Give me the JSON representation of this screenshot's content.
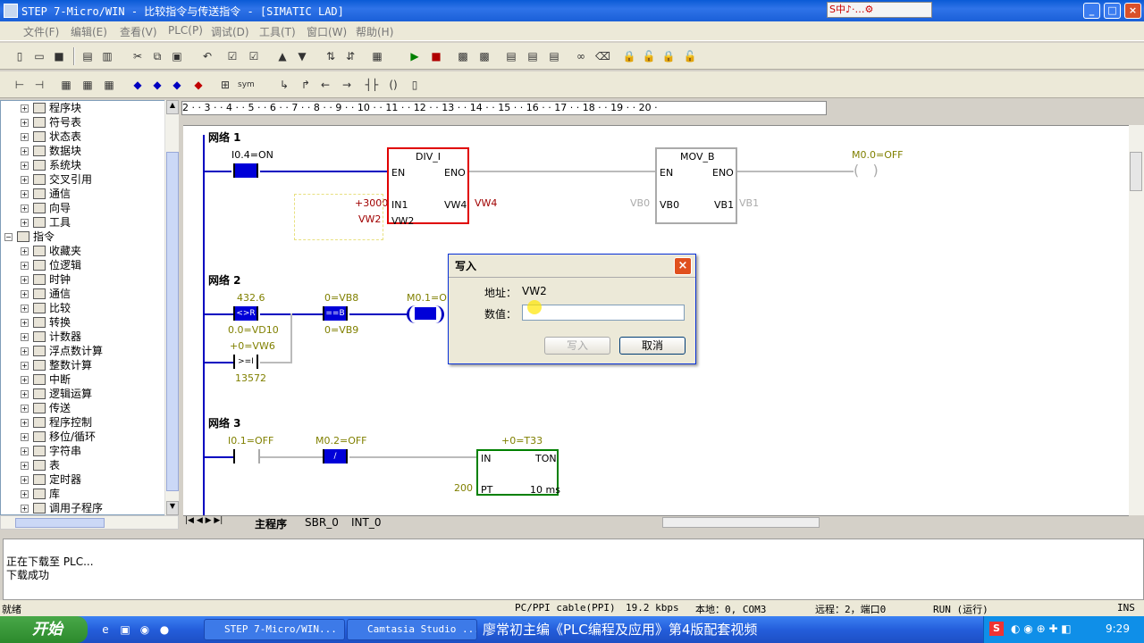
{
  "window": {
    "title": "STEP 7-Micro/WIN - 比较指令与传送指令 - [SIMATIC LAD]",
    "controls": {
      "min": "_",
      "max": "□",
      "close": "×"
    },
    "ime_text": "S中♪·…⚙"
  },
  "menu": [
    "文件(F)",
    "编辑(E)",
    "查看(V)",
    "PLC(P)",
    "调试(D)",
    "工具(T)",
    "窗口(W)",
    "帮助(H)"
  ],
  "tree": {
    "items": [
      {
        "label": "程序块",
        "level": 1
      },
      {
        "label": "符号表",
        "level": 1
      },
      {
        "label": "状态表",
        "level": 1
      },
      {
        "label": "数据块",
        "level": 1
      },
      {
        "label": "系统块",
        "level": 1
      },
      {
        "label": "交叉引用",
        "level": 1
      },
      {
        "label": "通信",
        "level": 1
      },
      {
        "label": "向导",
        "level": 1
      },
      {
        "label": "工具",
        "level": 1
      },
      {
        "label": "指令",
        "level": 0
      },
      {
        "label": "收藏夹",
        "level": 1
      },
      {
        "label": "位逻辑",
        "level": 1
      },
      {
        "label": "时钟",
        "level": 1
      },
      {
        "label": "通信",
        "level": 1
      },
      {
        "label": "比较",
        "level": 1
      },
      {
        "label": "转换",
        "level": 1
      },
      {
        "label": "计数器",
        "level": 1
      },
      {
        "label": "浮点数计算",
        "level": 1
      },
      {
        "label": "整数计算",
        "level": 1
      },
      {
        "label": "中断",
        "level": 1
      },
      {
        "label": "逻辑运算",
        "level": 1
      },
      {
        "label": "传送",
        "level": 1
      },
      {
        "label": "程序控制",
        "level": 1
      },
      {
        "label": "移位/循环",
        "level": 1
      },
      {
        "label": "字符串",
        "level": 1
      },
      {
        "label": "表",
        "level": 1
      },
      {
        "label": "定时器",
        "level": 1
      },
      {
        "label": "库",
        "level": 1
      },
      {
        "label": "调用子程序",
        "level": 1
      }
    ]
  },
  "ruler": "2 · · 3 · · 4 · · 5 · · 6 · · 7 · · 8 · · 9 · · 10 · · 11 · · 12 · · 13 · · 14 · · 15 · · 16 · · 17 · · 18 · · 19 · · 20 ·",
  "networks": {
    "n1": {
      "title": "网络 1",
      "contact": "I0.4=ON",
      "div": "DIV_I",
      "en": "EN",
      "eno": "ENO",
      "in1": "IN1",
      "in2": "VW2",
      "out": "VW4",
      "in1_val": "+3000",
      "in2_val": "VW2",
      "out_val": "VW4",
      "mov": "MOV_B",
      "mov_in": "VB0",
      "mov_out": "VB1",
      "mov_in_val": "VB0",
      "mov_out_val": "VB1",
      "coil": "M0.0=OFF"
    },
    "n2": {
      "title": "网络 2",
      "c1_top": "432.6",
      "c1_label": "<>R",
      "c1_bot": "0.0=VD10",
      "c2_top": "0=VB8",
      "c2_label": "==B",
      "c2_bot": "0=VB9",
      "coil": "M0.1=ON",
      "c3_top": "+0=VW6",
      "c3_label": ">=I",
      "c3_bot": "13572"
    },
    "n3": {
      "title": "网络 3",
      "c1": "I0.1=OFF",
      "c2": "M0.2=OFF",
      "c2_label": "/",
      "timer_top": "+0=T33",
      "in": "IN",
      "ton": "TON",
      "pt": "PT",
      "pt_val": "200",
      "res": "10 ms"
    }
  },
  "tabs": [
    "主程序",
    "SBR_0",
    "INT_0"
  ],
  "output": {
    "lines": [
      "正在下载至 PLC...",
      "下载成功"
    ]
  },
  "status": {
    "ready": "就绪",
    "cable": "PC/PPI cable(PPI)",
    "baud": "19.2 kbps",
    "local": "本地：0, COM3",
    "remote": "远程：2，端口0",
    "mode": "RUN (运行)",
    "ins": "INS"
  },
  "taskbar": {
    "start": "开始",
    "tasks": [
      "STEP 7-Micro/WIN...",
      "Camtasia Studio ..."
    ],
    "banner": "廖常初主编《PLC编程及应用》第4版配套视频",
    "clock": "9:29"
  },
  "dialog": {
    "title": "写入",
    "addr_label": "地址：",
    "addr_value": "VW2",
    "value_label": "数值：",
    "value": "",
    "write_btn": "写入",
    "cancel_btn": "取消"
  },
  "colors": {
    "title": "#0a5bd6",
    "flow": "#0000c0",
    "div_border": "#e00000",
    "timer_border": "#008000",
    "value_red": "#a00000",
    "value_olive": "#808000"
  }
}
